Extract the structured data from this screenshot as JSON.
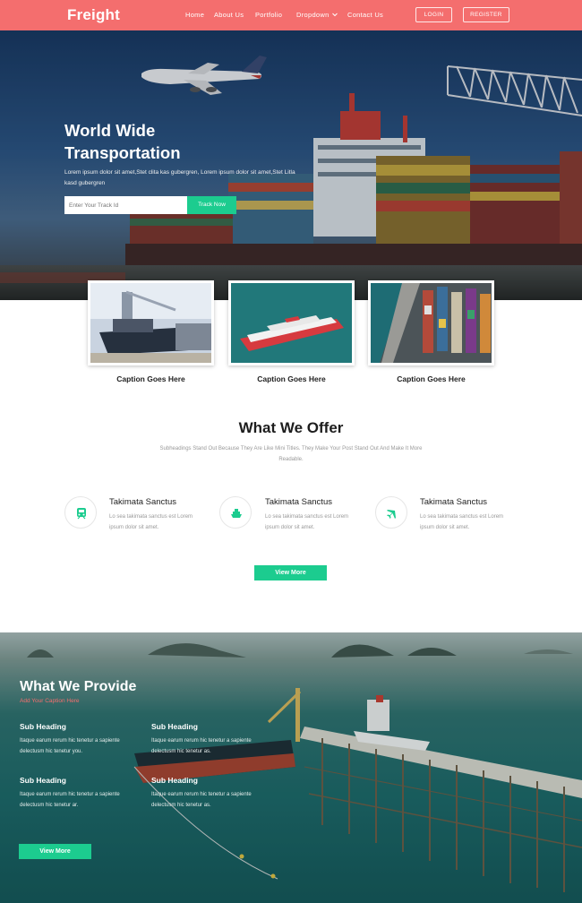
{
  "nav": {
    "brand": "Freight",
    "items": [
      "Home",
      "About Us",
      "Portfolio",
      "Dropdown",
      "Contact Us"
    ],
    "login": "LOGIN",
    "register": "REGISTER"
  },
  "hero": {
    "title": "World Wide Transportation",
    "text": "Lorem ipsum dolor sit amet,Stet clita kas gubergren, Lorem ipsum dolor sit amet,Stet Litla kasd gubergren",
    "track_placeholder": "Enter Your Track Id",
    "track_button": "Track Now"
  },
  "captions": [
    "Caption Goes Here",
    "Caption Goes Here",
    "Caption Goes Here"
  ],
  "offer": {
    "title": "What We Offer",
    "subtitle": "Subheadings Stand Out Because They Are Like Mini Titles. They Make Your Post Stand Out And Make It More Readable.",
    "features": [
      {
        "icon": "train-icon",
        "title": "Takimata Sanctus",
        "text": "Lo sea takimata sanctus est Lorem ipsum dolor sit amet."
      },
      {
        "icon": "ship-icon",
        "title": "Takimata Sanctus",
        "text": "Lo sea takimata sanctus est Lorem ipsum dolor sit amet."
      },
      {
        "icon": "plane-icon",
        "title": "Takimata Sanctus",
        "text": "Lo sea takimata sanctus est Lorem ipsum dolor sit amet."
      }
    ],
    "button": "View More"
  },
  "provide": {
    "title": "What We Provide",
    "subtitle": "Add Your Caption Here",
    "items": [
      {
        "heading": "Sub Heading",
        "text": "Itaque earum rerum hic tenetur a sapiente delectusm hic tenetur you."
      },
      {
        "heading": "Sub Heading",
        "text": "Itaque earum rerum hic tenetur a sapiente delectusm hic tenetur as."
      },
      {
        "heading": "Sub Heading",
        "text": "Itaque earum rerum hic tenetur a sapiente delectusm hic tenetur ar."
      },
      {
        "heading": "Sub Heading",
        "text": "Itaque earum rerum hic tenetur a sapiente delectusm hic tenetur as."
      }
    ],
    "button": "View More"
  },
  "colors": {
    "brand_coral": "#f46e6e",
    "accent_green": "#1ccc8f"
  }
}
